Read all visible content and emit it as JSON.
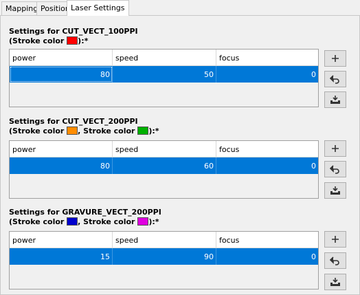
{
  "tabs": [
    "Mapping",
    "Position",
    "Laser Settings"
  ],
  "active_tab": "Laser Settings",
  "columns": [
    "power",
    "speed",
    "focus"
  ],
  "groups": [
    {
      "title": "Settings for CUT_VECT_100PPI",
      "stroke_prefix": "(Stroke color ",
      "stroke_suffix": "):*",
      "separator": ", Stroke color ",
      "colors": [
        "#ff0000"
      ],
      "row": {
        "power": "80",
        "speed": "50",
        "focus": "0"
      }
    },
    {
      "title": "Settings for CUT_VECT_200PPI",
      "stroke_prefix": "(Stroke color ",
      "stroke_suffix": "):*",
      "separator": ", Stroke color ",
      "colors": [
        "#ff8c00",
        "#00b000"
      ],
      "row": {
        "power": "80",
        "speed": "60",
        "focus": "0"
      }
    },
    {
      "title": "Settings for GRAVURE_VECT_200PPI",
      "stroke_prefix": "(Stroke color ",
      "stroke_suffix": "):*",
      "separator": ", Stroke color ",
      "colors": [
        "#0000cc",
        "#e000e0"
      ],
      "row": {
        "power": "15",
        "speed": "90",
        "focus": "0"
      }
    }
  ],
  "buttons": {
    "add_icon": "plus-icon",
    "reset_icon": "undo-arrow-icon",
    "save_icon": "save-tray-icon"
  }
}
